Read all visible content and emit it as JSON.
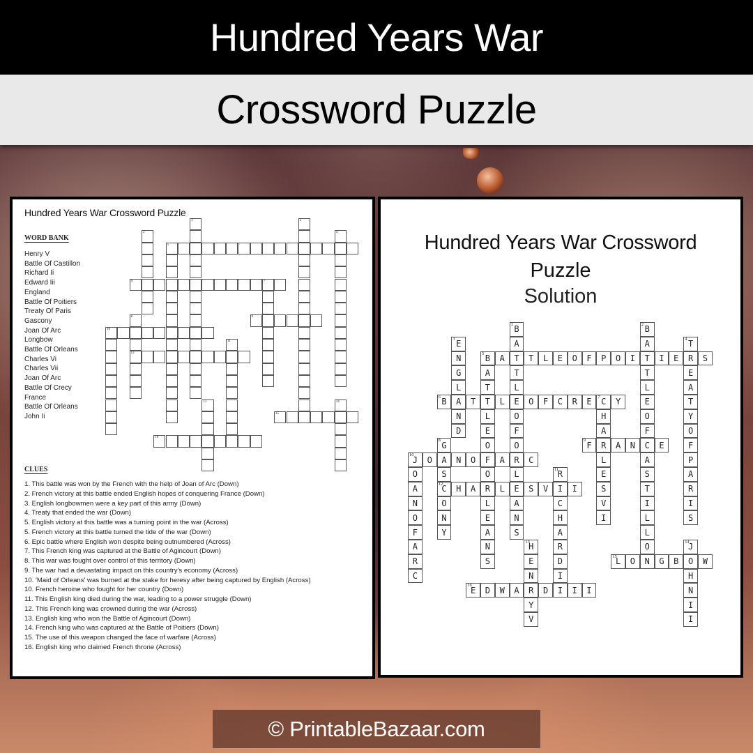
{
  "header": {
    "title": "Hundred Years War",
    "subtitle": "Crossword Puzzle"
  },
  "worksheet": {
    "title": "Hundred Years War Crossword Puzzle",
    "word_bank_heading": "WORD BANK",
    "word_bank": [
      "Henry V",
      "Battle Of Castillon",
      "Richard Ii",
      "Edward Iii",
      "England",
      "Battle Of Poitiers",
      "Treaty Of Paris",
      "Gascony",
      "Joan Of Arc",
      "Longbow",
      "Battle Of Orleans",
      "Charles Vi",
      "Charles Vii",
      "Joan Of Arc",
      "Battle Of Crecy",
      "France",
      "Battle Of Orleans",
      "John Ii"
    ],
    "clues_heading": "CLUES",
    "clues": [
      "1. This battle was won by the French with the help of Joan of Arc (Down)",
      "2. French victory at this battle ended English hopes of conquering France (Down)",
      "3. English longbowmen were a key part of this army (Down)",
      "4. Treaty that ended the war (Down)",
      "5. English victory at this battle was a turning point in the war (Across)",
      "5. French victory at this battle turned the tide of the war (Down)",
      "6. Epic battle where English won despite being outnumbered  (Across)",
      "7. This French king was captured at the Battle of Agincourt (Down)",
      "8. This war was fought over control of this territory (Down)",
      "9. The war had a devastating impact on this country's economy (Across)",
      "10. 'Maid of Orleans' was burned at the stake for heresy after being captured by English (Across)",
      "10. French heroine who fought for her country (Down)",
      "11. This English king died during the war, leading to a power struggle (Down)",
      "12. This French king was crowned during the war (Across)",
      "13. English king who won the Battle of Agincourt (Down)",
      "14. French king who was captured at the Battle of Poitiers (Down)",
      "15. The use of this weapon changed the face of warfare (Across)",
      "16. English king who claimed French throne (Across)"
    ]
  },
  "solution": {
    "title_line1": "Hundred Years War Crossword",
    "title_line2": "Puzzle",
    "title_line3": "Solution"
  },
  "crossword": {
    "entries": [
      {
        "num": 1,
        "dir": "down",
        "col": 7,
        "row": 0,
        "answer": "BATTLEOFORLEANS"
      },
      {
        "num": 2,
        "dir": "down",
        "col": 16,
        "row": 0,
        "answer": "BATTLEOFCASTILLON"
      },
      {
        "num": 3,
        "dir": "down",
        "col": 3,
        "row": 1,
        "answer": "ENGLAND"
      },
      {
        "num": 4,
        "dir": "down",
        "col": 19,
        "row": 1,
        "answer": "TREATYOFPARIS"
      },
      {
        "num": 5,
        "dir": "across",
        "col": 5,
        "row": 2,
        "answer": "BATTLEOFPOITIERS"
      },
      {
        "num": 5,
        "dir": "down",
        "col": 5,
        "row": 2,
        "answer": "BATTLEOFORLEANS"
      },
      {
        "num": 6,
        "dir": "across",
        "col": 2,
        "row": 5,
        "answer": "BATTLEOFCRECY"
      },
      {
        "num": 7,
        "dir": "down",
        "col": 13,
        "row": 5,
        "answer": "CHARLESVI"
      },
      {
        "num": 8,
        "dir": "down",
        "col": 2,
        "row": 8,
        "answer": "GASCONY"
      },
      {
        "num": 9,
        "dir": "across",
        "col": 12,
        "row": 8,
        "answer": "FRANCE"
      },
      {
        "num": 10,
        "dir": "across",
        "col": 0,
        "row": 9,
        "answer": "JOANOFARC"
      },
      {
        "num": 10,
        "dir": "down",
        "col": 0,
        "row": 9,
        "answer": "JOANOFARC"
      },
      {
        "num": 11,
        "dir": "down",
        "col": 10,
        "row": 10,
        "answer": "RICHARDII"
      },
      {
        "num": 12,
        "dir": "across",
        "col": 2,
        "row": 11,
        "answer": "CHARLESVII"
      },
      {
        "num": 13,
        "dir": "down",
        "col": 8,
        "row": 15,
        "answer": "HENRYV"
      },
      {
        "num": 14,
        "dir": "down",
        "col": 19,
        "row": 15,
        "answer": "JOHNII"
      },
      {
        "num": 15,
        "dir": "across",
        "col": 14,
        "row": 16,
        "answer": "LONGBOW"
      },
      {
        "num": 16,
        "dir": "across",
        "col": 4,
        "row": 18,
        "answer": "EDWARDIII"
      }
    ]
  },
  "footer": {
    "copyright": "© PrintableBazaar.com"
  }
}
